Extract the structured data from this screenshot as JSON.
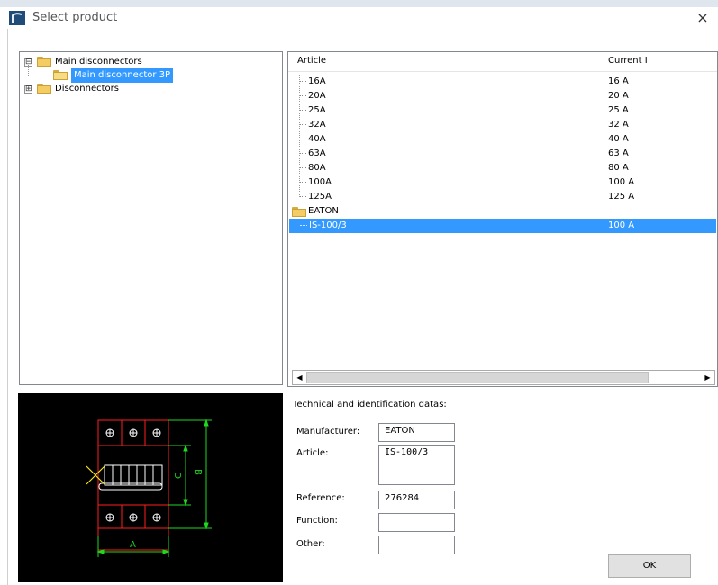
{
  "window": {
    "title": "Select product",
    "close_glyph": "×"
  },
  "tree": {
    "items": [
      {
        "label": "Main disconnectors",
        "expanded": true,
        "expander": "⊟"
      },
      {
        "label": "Main disconnector 3P",
        "selected": true
      },
      {
        "label": "Disconnectors",
        "expanded": false,
        "expander": "⊞"
      }
    ]
  },
  "list": {
    "columns": [
      "Article",
      "Current I"
    ],
    "rows": [
      {
        "article": "16A",
        "current": "16 A"
      },
      {
        "article": "20A",
        "current": "20 A"
      },
      {
        "article": "25A",
        "current": "25 A"
      },
      {
        "article": "32A",
        "current": "32 A"
      },
      {
        "article": "40A",
        "current": "40 A"
      },
      {
        "article": "63A",
        "current": "63 A"
      },
      {
        "article": "80A",
        "current": "80 A"
      },
      {
        "article": "100A",
        "current": "100 A"
      },
      {
        "article": "125A",
        "current": "125 A"
      }
    ],
    "group": "EATON",
    "selected_row": {
      "article": "IS-100/3",
      "current": "100 A"
    },
    "scroll_left": "◀",
    "scroll_right": "▶"
  },
  "drawing": {
    "dim_a": "A",
    "dim_b": "B",
    "dim_c": "C"
  },
  "details": {
    "title": "Technical and identification datas:",
    "fields": [
      {
        "label": "Manufacturer:",
        "value": "EATON"
      },
      {
        "label": "Article:",
        "value": "IS-100/3"
      },
      {
        "label": "Reference:",
        "value": "276284"
      },
      {
        "label": "Function:",
        "value": ""
      },
      {
        "label": "Other:",
        "value": ""
      }
    ]
  },
  "buttons": {
    "ok": "OK"
  },
  "colors": {
    "selection": "#3399ff",
    "drawing_bg": "#000000",
    "drawing_red": "#ff2020",
    "drawing_green": "#1fd81f",
    "drawing_white": "#ffffff"
  }
}
